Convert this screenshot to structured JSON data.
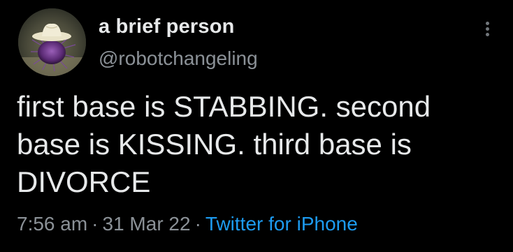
{
  "author": {
    "display_name": "a brief person",
    "handle": "@robotchangeling",
    "avatar_icon": "cowboy-hat-sea-urchin-avatar"
  },
  "more_button": {
    "icon": "more-vertical-icon"
  },
  "tweet": {
    "lines": [
      "first base is STABBING. second",
      "base is KISSING. third base is",
      "DIVORCE"
    ]
  },
  "meta": {
    "time": "7:56 am",
    "separator": "·",
    "date": "31 Mar 22",
    "source": "Twitter for iPhone"
  },
  "colors": {
    "background": "#000000",
    "text": "#e7e9ea",
    "secondary_text": "#8b9197",
    "link": "#1d9bf0"
  }
}
